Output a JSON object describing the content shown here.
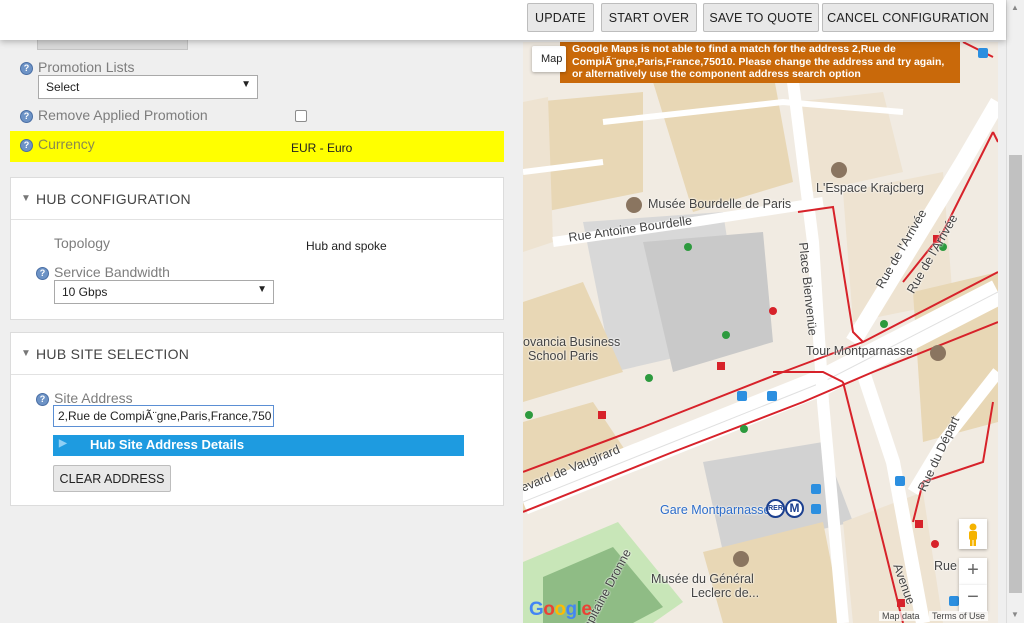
{
  "toolbar": {
    "update": "UPDATE",
    "start_over": "START OVER",
    "save_to_quote": "SAVE TO QUOTE",
    "cancel_configuration": "CANCEL CONFIGURATION"
  },
  "form": {
    "promotion_lists_label": "Promotion Lists",
    "promotion_lists_value": "Select",
    "remove_applied_promotion_label": "Remove Applied Promotion",
    "remove_applied_promotion_checked": false,
    "currency_label": "Currency",
    "currency_value": "EUR - Euro",
    "highlight_color": "#ffff00"
  },
  "hub_configuration": {
    "title": "HUB CONFIGURATION",
    "topology_label": "Topology",
    "topology_value": "Hub and spoke",
    "bandwidth_label": "Service Bandwidth",
    "bandwidth_value": "10 Gbps"
  },
  "hub_site_selection": {
    "title": "HUB SITE SELECTION",
    "site_address_label": "Site Address",
    "site_address_value": "2,Rue de CompiÃ¨gne,Paris,France,750",
    "details_label": "Hub Site Address Details",
    "details_color": "#1e9be0",
    "clear_address": "CLEAR ADDRESS"
  },
  "map": {
    "warning": "Google Maps is not able to find a match for the address 2,Rue de CompiÃ¨gne,Paris,France,75010. Please change the address and try again, or alternatively use the component address search option",
    "warning_color": "#c9690a",
    "map_type": "Map",
    "labels": {
      "bourdelle_museum": "Musée Bourdelle de Paris",
      "espace_krajcberg": "L'Espace Krajcberg",
      "rue_antoine_bourdelle": "Rue Antoine Bourdelle",
      "place_bienvenue": "Place Bienvenüe",
      "rue_arrivee_1": "Rue de l'Arrivée",
      "rue_arrivee_2": "Rue de l'Arrivée",
      "novancia_1": "ovancia Business",
      "novancia_2": "School Paris",
      "tour_montparnasse": "Tour Montparnasse",
      "vaugirard": "levard de Vaugirard",
      "rue_du_depart": "Rue du Départ",
      "gare_montparnasse": "Gare Montparnasse",
      "rue_capitaine": "apitaine Dronne",
      "musee_leclerc_1": "Musée du Général",
      "musee_leclerc_2": "Leclerc de...",
      "avenue": "Avenue",
      "rue_right": "Rue"
    },
    "metro_rer": "RER",
    "metro_m": "M",
    "zoom_in": "+",
    "zoom_out": "−",
    "attribution": "Map data",
    "terms": "Terms of Use",
    "logo": "Google"
  }
}
